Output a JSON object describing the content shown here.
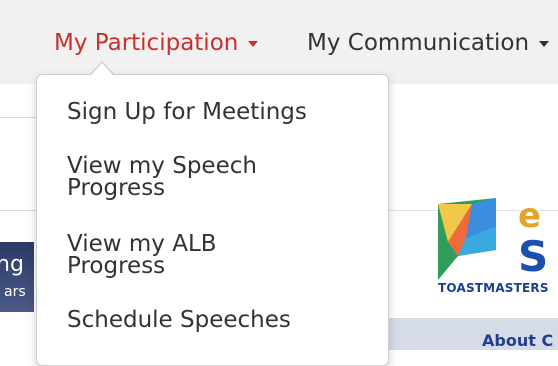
{
  "nav": {
    "items": [
      {
        "label": "My Participation",
        "active": true
      },
      {
        "label": "My Communication",
        "active": false
      }
    ]
  },
  "dropdown": {
    "items": [
      {
        "line1": "Sign Up for Meetings",
        "line2": ""
      },
      {
        "line1": "View my Speech",
        "line2": "Progress"
      },
      {
        "line1": "View my ALB",
        "line2": "Progress"
      },
      {
        "line1": "Schedule Speeches",
        "line2": ""
      }
    ]
  },
  "background": {
    "banner_fragment_1": "ng",
    "banner_fragment_2": "ars",
    "logo_letter_1": "e",
    "logo_letter_2": "S",
    "logo_caption": "TOASTMASTERS",
    "about_link": "About C"
  },
  "colors": {
    "active_nav": "#c8302e",
    "nav_bg": "#f1f1f1",
    "text": "#333333",
    "link": "#1f3f8f"
  }
}
